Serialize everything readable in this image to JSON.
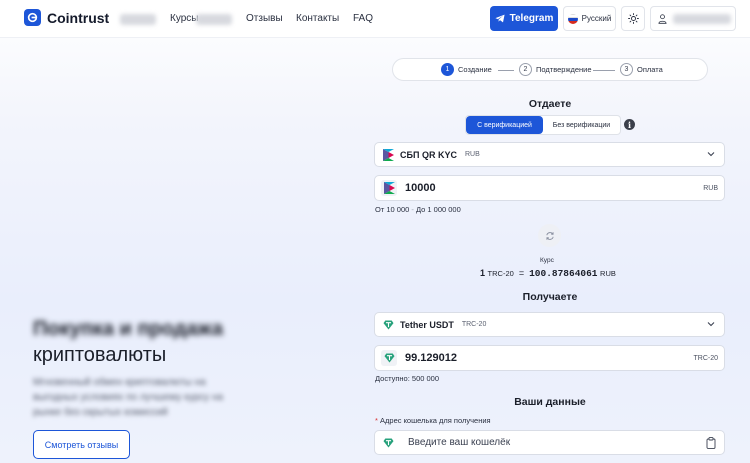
{
  "header": {
    "logo_text": "Cointrust",
    "nav": [
      "Курсы",
      "Отзывы",
      "Контакты",
      "FAQ"
    ],
    "telegram_label": "Telegram",
    "language_label": "Русский"
  },
  "hero": {
    "title_line2": "криптовалюты",
    "reviews_button": "Смотреть отзывы"
  },
  "stepper": {
    "steps": [
      {
        "num": "1",
        "label": "Создание"
      },
      {
        "num": "2",
        "label": "Подтверждение"
      },
      {
        "num": "3",
        "label": "Оплата"
      }
    ]
  },
  "give": {
    "title": "Отдаете",
    "toggle": [
      "С верификацией",
      "Без верификации"
    ],
    "method_name": "СБП QR KYC",
    "method_currency": "RUB",
    "amount": "10000",
    "amount_suffix": "RUB",
    "limits_from": "От 10 000",
    "limits_sep": "-",
    "limits_to": "До 1 000 000"
  },
  "rate": {
    "label": "Курс",
    "left_num": "1",
    "left_cur": "TRC-20",
    "eq": "=",
    "right_num": "100.87864061",
    "right_cur": "RUB"
  },
  "receive": {
    "title": "Получаете",
    "coin_name": "Tether USDT",
    "coin_network": "TRC-20",
    "amount": "99.129012",
    "amount_suffix": "TRC-20",
    "available": "Доступно: 500 000"
  },
  "your_data": {
    "title": "Ваши данные",
    "wallet_label_star": "*",
    "wallet_label": "Адрес кошелька для получения",
    "wallet_placeholder": "Введите ваш кошелёк"
  },
  "colors": {
    "accent": "#1d56d8",
    "tether": "#26a17b"
  }
}
